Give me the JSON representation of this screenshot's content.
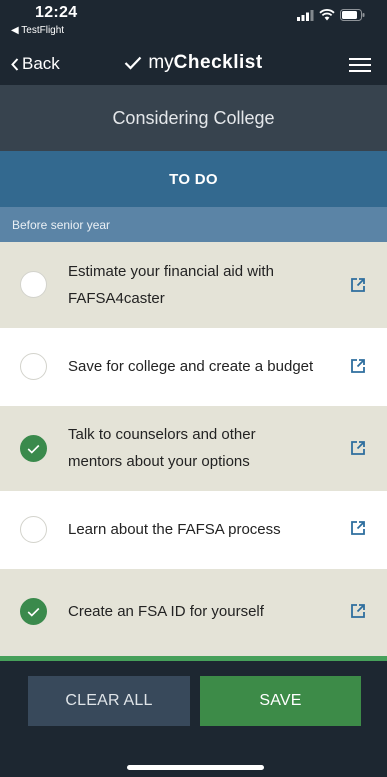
{
  "status_bar": {
    "time": "12:24",
    "back_app": "◀ TestFlight"
  },
  "nav": {
    "back_label": "Back",
    "brand_light": "my",
    "brand_bold": "Checklist"
  },
  "page": {
    "title": "Considering College",
    "tab_label": "TO DO",
    "section_label": "Before senior year"
  },
  "tasks": [
    {
      "line1": "Estimate your financial aid with",
      "line2": "FAFSA4caster",
      "checked": false
    },
    {
      "line1": "Save for college and create a budget",
      "line2": "",
      "checked": false
    },
    {
      "line1": "Talk to counselors and other",
      "line2": "mentors about your options",
      "checked": true
    },
    {
      "line1": "Learn about the FAFSA process",
      "line2": "",
      "checked": false
    },
    {
      "line1": "Create an FSA ID for yourself",
      "line2": "",
      "checked": true
    }
  ],
  "footer": {
    "clear_label": "CLEAR ALL",
    "save_label": "SAVE"
  },
  "colors": {
    "nav_bg": "#1d2731",
    "header_bg": "#37434e",
    "tab_bg": "#33698f",
    "section_bg": "#5b84a6",
    "row_shaded": "#e4e3d7",
    "check_green": "#3a8a4c",
    "link_blue": "#2e6e9e",
    "save_green": "#3d8b48",
    "clear_bg": "#38495b"
  },
  "icons": {
    "menu": "hamburger-menu-icon",
    "back": "chevron-left-icon",
    "brand_mark": "checkmark-icon",
    "external_link": "external-link-icon",
    "check": "checkmark-icon"
  }
}
